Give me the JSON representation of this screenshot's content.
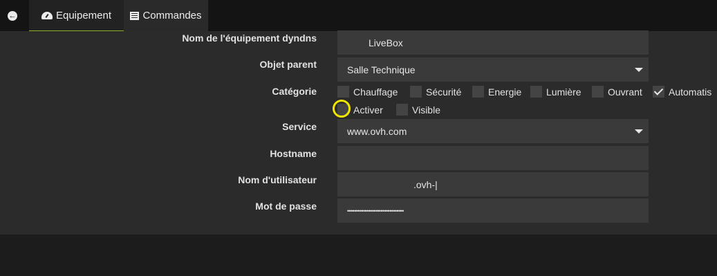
{
  "tabs": {
    "back_icon": "arrow-left-circle-icon",
    "equipement": {
      "label": "Equipement",
      "icon": "dashboard-gauge-icon"
    },
    "commandes": {
      "label": "Commandes",
      "icon": "list-icon"
    }
  },
  "form": {
    "name": {
      "label": "Nom de l'équipement dyndns",
      "value": "LiveBox"
    },
    "parent": {
      "label": "Objet parent",
      "value": "Salle Technique"
    },
    "category": {
      "label": "Catégorie",
      "options": [
        {
          "label": "Chauffage",
          "checked": false
        },
        {
          "label": "Sécurité",
          "checked": false
        },
        {
          "label": "Energie",
          "checked": false
        },
        {
          "label": "Lumière",
          "checked": false
        },
        {
          "label": "Ouvrant",
          "checked": false
        },
        {
          "label": "Automatis",
          "checked": true
        }
      ]
    },
    "flags": [
      {
        "label": "Activer",
        "checked": false
      },
      {
        "label": "Visible",
        "checked": false
      }
    ],
    "service": {
      "label": "Service",
      "value": "www.ovh.com"
    },
    "hostname": {
      "label": "Hostname",
      "value": ""
    },
    "username": {
      "label": "Nom d'utilisateur",
      "value": ".ovh-|"
    },
    "password": {
      "label": "Mot de passe",
      "value": "••••••••••••••••••••••••••••••••"
    }
  },
  "colors": {
    "accent": "#8fae2a",
    "highlight": "#f0e600",
    "panel": "#2b2b2b",
    "input": "#3a3a3a"
  }
}
